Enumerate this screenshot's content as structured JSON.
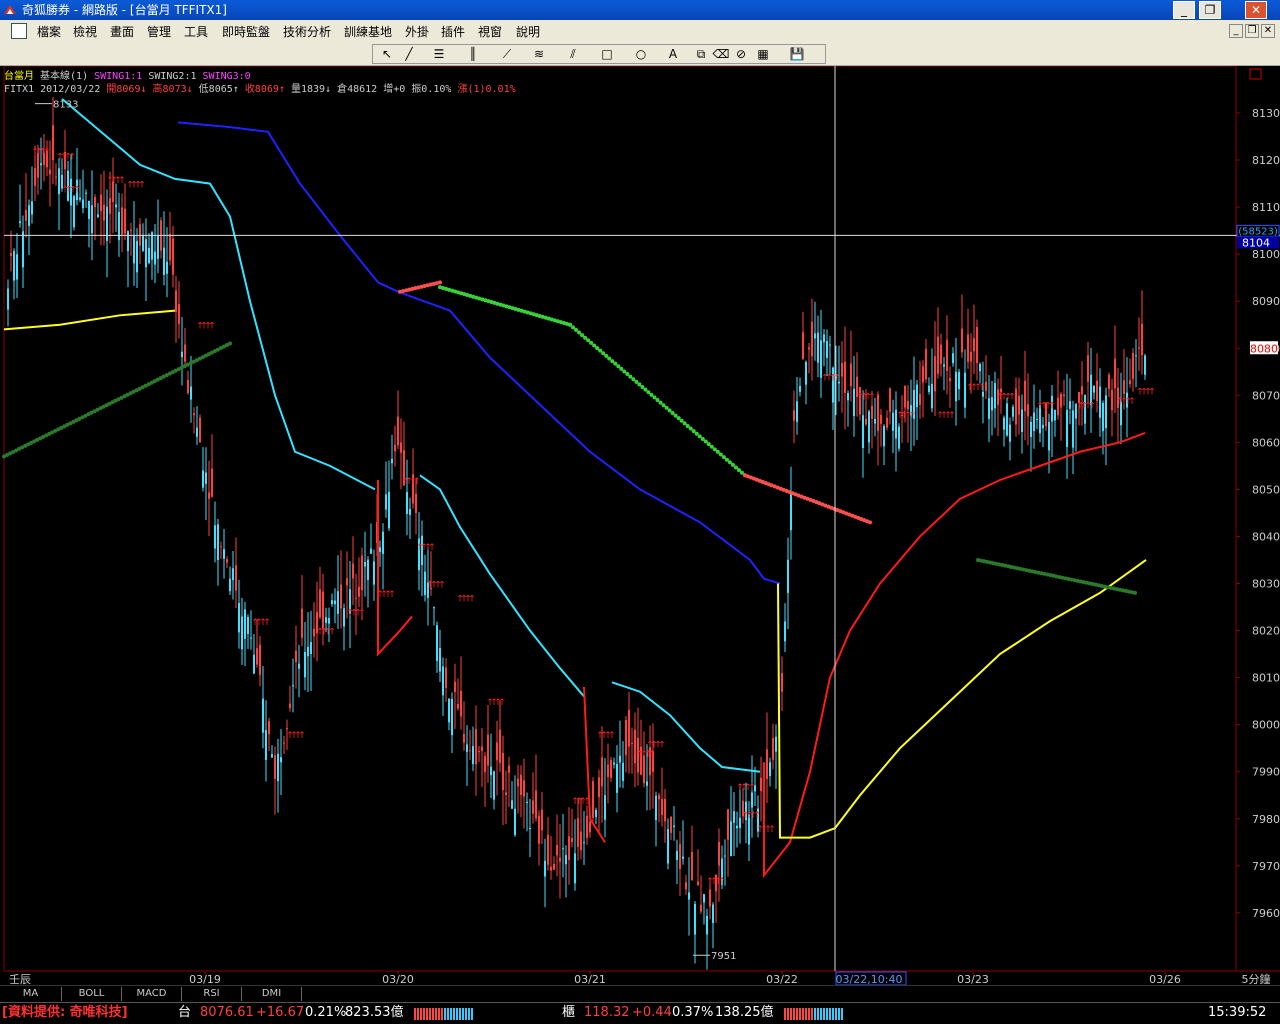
{
  "window": {
    "title": "奇狐勝券 - 網路版 - [台當月 TFFITX1]"
  },
  "menu": [
    "檔案",
    "檢視",
    "畫面",
    "管理",
    "工具",
    "即時監盤",
    "技術分析",
    "訓練基地",
    "外掛",
    "插件",
    "視窗",
    "說明"
  ],
  "chart": {
    "info_line1": {
      "symbol": "台當月",
      "base_line": "基本線(1)",
      "swing1": "SWING1:1",
      "swing2": "SWING2:1",
      "swing3": "SWING3:0"
    },
    "info_line2": {
      "code": "FITX1",
      "date": "2012/03/22",
      "open": "開8069↓",
      "high": "高8073↓",
      "low": "低8065↑",
      "close": "收8069↑",
      "volume": "量1839↓",
      "oi": "倉48612",
      "change": "增+0",
      "amp": "振0.10%",
      "rise": "漲(1)0.01%"
    },
    "y_ticks": [
      "8130",
      "8120",
      "8110",
      "8100",
      "8090",
      "8080",
      "8070",
      "8060",
      "8050",
      "8040",
      "8030",
      "8020",
      "8010",
      "8000",
      "7990",
      "7980",
      "7970",
      "7960"
    ],
    "crosshair_volume": "(58523)",
    "crosshair_price": "8104",
    "last_price_tag": "8080",
    "high_annotation": "8133",
    "low_annotation": "7951",
    "x_ticks": [
      "壬辰",
      "03/19",
      "03/20",
      "03/21",
      "03/22",
      "03/23",
      "03/26"
    ],
    "crosshair_time": "03/22,10:40",
    "period": "5分鐘"
  },
  "indicator_tabs": [
    "MA",
    "BOLL",
    "MACD",
    "RSI",
    "DMI"
  ],
  "status": {
    "provider": "[資料提供: 奇唯科技]",
    "idx1_name": "台",
    "idx1_value": "8076.61",
    "idx1_change": "+16.67",
    "idx1_pct": "0.21%",
    "idx1_amount": "823.53億",
    "idx2_name": "櫃",
    "idx2_value": "118.32",
    "idx2_change": "+0.44",
    "idx2_pct": "0.37%",
    "idx2_amount": "138.25億",
    "time": "15:39:52"
  },
  "colors": {
    "ma_blue": "#1e22ff",
    "ma_cyan": "#33e3ff",
    "ma_red": "#ff1a1a",
    "ma_yellow": "#ffff20",
    "swing_green": "#39d139",
    "swing_dark_green": "#2b7a2b",
    "up_candle": "#ff4040",
    "down_candle": "#40e0ff"
  }
}
